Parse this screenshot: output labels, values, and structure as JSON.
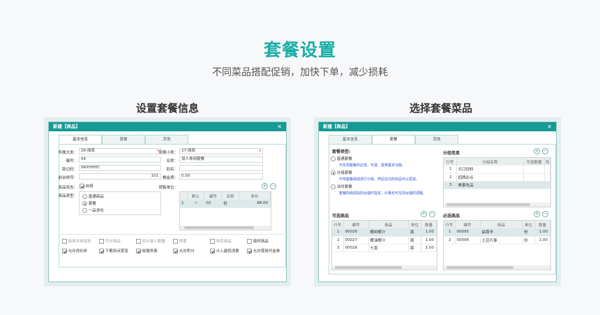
{
  "header": {
    "title": "套餐设置",
    "subtitle": "不同菜品搭配促销，加快下单，减少损耗"
  },
  "left": {
    "caption": "设置套餐信息",
    "window_title": "新建【商品】",
    "tabs": [
      {
        "label": "基本信息"
      },
      {
        "label": "套餐"
      },
      {
        "label": "其他"
      }
    ],
    "form": {
      "category_label": "所属大类：",
      "category_value": "26-简库",
      "subcategory_label": "所属小类：",
      "subcategory_value": "27-简库",
      "code_label": "编号：",
      "code_value": "04",
      "name_label": "名称：",
      "name_value": "双人休闲套餐",
      "mnemonic_label": "助记码：",
      "mnemonic_value": "SRXHHHC",
      "alias_label": "别名：",
      "alias_value": "",
      "sort_label": "前台排序：",
      "sort_value": "101",
      "box_fee_label": "餐盒费：",
      "box_fee_value": "0.00",
      "status_label": "商品状态：",
      "status_option": "启用",
      "type_label": "商品类型：",
      "types": [
        "普通商品",
        "套餐",
        "一品多吃"
      ],
      "sale_unit_label": "销售单位："
    },
    "unit_table": {
      "headers": [
        "",
        "默认",
        "编号",
        "名称",
        "卖价"
      ],
      "rows": [
        [
          "1",
          "✓",
          "02",
          "份",
          "88.00"
        ]
      ]
    },
    "checks_row1": [
      {
        "label": "启用专用状态",
        "on": false,
        "disabled": true
      },
      {
        "label": "可计商品",
        "on": false,
        "disabled": true
      },
      {
        "label": "扣计录入数量",
        "on": false,
        "disabled": true
      },
      {
        "label": "称重",
        "on": false,
        "disabled": true
      },
      {
        "label": "特色商品",
        "on": false,
        "disabled": true
      },
      {
        "label": "临时商品",
        "on": false,
        "disabled": false
      }
    ],
    "checks_row2": [
      {
        "label": "允许改价折",
        "on": true
      },
      {
        "label": "下载到点菜宝",
        "on": true
      },
      {
        "label": "收服务费",
        "on": true
      },
      {
        "label": "允许积分",
        "on": true
      },
      {
        "label": "计入最低消费",
        "on": true
      },
      {
        "label": "允许使用代金券",
        "on": true
      }
    ]
  },
  "right": {
    "caption": "选择套餐菜品",
    "window_title": "新建【商品】",
    "tabs": [
      {
        "label": "基本信息"
      },
      {
        "label": "套餐"
      },
      {
        "label": "其他"
      }
    ],
    "combo_type_label": "套餐类型:",
    "options": [
      {
        "label": "普通套餐",
        "desc": "可实现套餐的必选、可选、替换基本功能。",
        "on": false
      },
      {
        "label": "分组套餐",
        "desc": "可将套餐组成进行分组，然后在内的商品可以更选。",
        "on": true
      },
      {
        "label": "法时套餐",
        "desc": "套餐的组成由前台临时指定，价格也可在前台临时调整。",
        "on": false
      }
    ],
    "group_title": "分组信息",
    "group_table": {
      "headers": [
        "行号",
        "分组名称",
        "可选数量",
        "改"
      ],
      "rows": [
        [
          "1",
          "大口饮料",
          "",
          ""
        ],
        [
          "2",
          "招牌必点",
          "",
          ""
        ],
        [
          "3",
          "美事吃品",
          "",
          ""
        ]
      ]
    },
    "optional_title": "可选商品",
    "optional_table": {
      "headers": [
        "行号",
        "编号",
        "商品",
        "单位",
        "数量"
      ],
      "rows": [
        [
          "1",
          "00026",
          "椰树椰汁",
          "瓶",
          "1.00"
        ],
        [
          "2",
          "00027",
          "椰油椰汁",
          "瓶",
          "1.00"
        ],
        [
          "3",
          "00028",
          "七喜",
          "瓶",
          "1.00"
        ]
      ]
    },
    "required_title": "必选商品",
    "required_table": {
      "headers": [
        "行号",
        "编号",
        "商品",
        "单位",
        "数量"
      ],
      "rows": [
        [
          "1",
          "00095",
          "兹周辛",
          "份",
          "1.00"
        ],
        [
          "2",
          "00096",
          "土豆片事",
          "份",
          "1.00"
        ]
      ]
    }
  }
}
